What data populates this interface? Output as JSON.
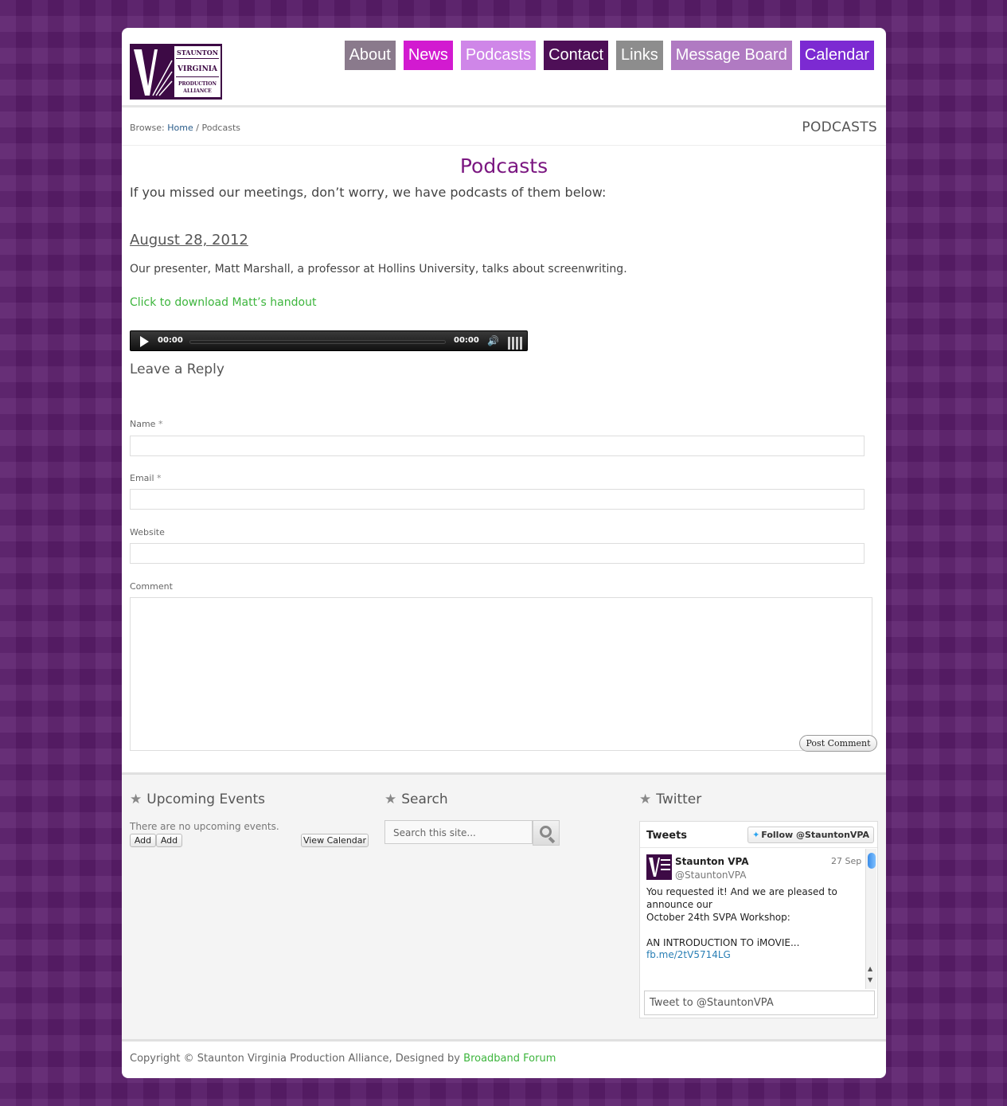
{
  "logo": {
    "lines": [
      "STAUNTON",
      "VIRGINIA",
      "PRODUCTION",
      "ALLIANCE"
    ],
    "color": "#3d0a45"
  },
  "nav": [
    {
      "label": "About",
      "color": "#8a7a8c"
    },
    {
      "label": "News",
      "color": "#d21ad0"
    },
    {
      "label": "Podcasts",
      "color": "#cf86e8"
    },
    {
      "label": "Contact",
      "color": "#4e0f57"
    },
    {
      "label": "Links",
      "color": "#8d8d8d"
    },
    {
      "label": "Message Board",
      "color": "#b07ac2"
    },
    {
      "label": "Calendar",
      "color": "#7c2ad2"
    }
  ],
  "breadcrumb": {
    "prefix": "Browse:",
    "home": "Home",
    "separator": "/",
    "current": "Podcasts",
    "page_label": "PODCASTS"
  },
  "content": {
    "title": "Podcasts",
    "intro": "If you missed our meetings, don’t worry, we have podcasts of them below:",
    "episode": {
      "date": "August 28, 2012",
      "description": "Our presenter, Matt Marshall, a professor at Hollins University, talks about screenwriting.",
      "download_link": "Click to download Matt’s handout"
    },
    "player": {
      "current_time": "00:00",
      "duration": "00:00",
      "progress": 0
    }
  },
  "reply": {
    "title": "Leave a Reply",
    "name_label": "Name",
    "email_label": "Email",
    "required_mark": "*",
    "website_label": "Website",
    "comment_label": "Comment",
    "submit": "Post Comment"
  },
  "widgets": {
    "events": {
      "title": "Upcoming Events",
      "empty_text": "There are no upcoming events.",
      "add_1": "Add",
      "add_2": "Add",
      "view_calendar": "View Calendar"
    },
    "search": {
      "title": "Search",
      "placeholder": "Search this site..."
    },
    "twitter": {
      "title": "Twitter",
      "header": "Tweets",
      "follow": "Follow @StauntonVPA",
      "tweet": {
        "name": "Staunton VPA",
        "handle": "@StauntonVPA",
        "date": "27 Sep",
        "text": "You requested it!  And we are pleased to announce our\nOctober 24th SVPA Workshop:\n\nAN INTRODUCTION TO iMOVIE...",
        "link": "fb.me/2tV5714LG"
      },
      "compose_placeholder": "Tweet to @StauntonVPA"
    }
  },
  "footer": {
    "copyright": "Copyright © Staunton Virginia Production Alliance, Designed by",
    "designer": "Broadband Forum"
  }
}
